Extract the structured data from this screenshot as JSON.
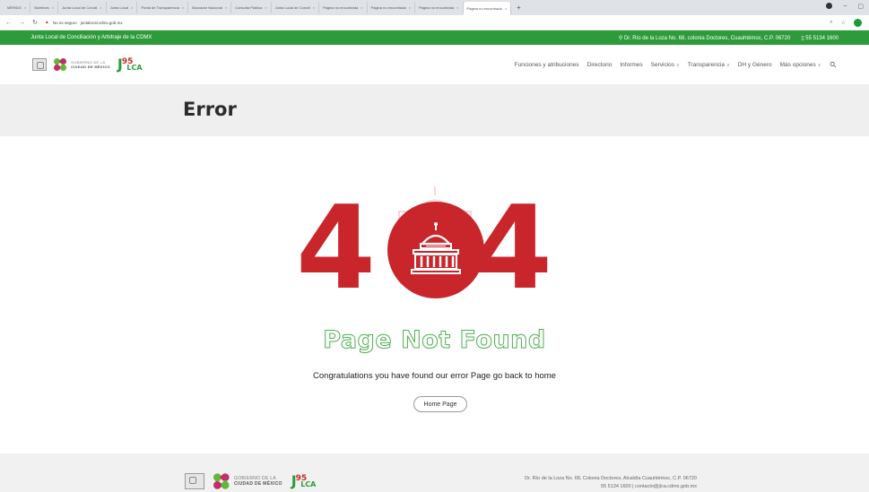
{
  "browser": {
    "tabs": [
      {
        "label": "MÉRIDO",
        "active": false
      },
      {
        "label": "Boletines",
        "active": false
      },
      {
        "label": "Junta Local de Concili",
        "active": false
      },
      {
        "label": "Junta Local",
        "active": false
      },
      {
        "label": "Portal de Transparencia",
        "active": false
      },
      {
        "label": "Buscador Nacional",
        "active": false
      },
      {
        "label": "Consulta Pública",
        "active": false
      },
      {
        "label": "Junta Local de Concili",
        "active": false
      },
      {
        "label": "Página no encontrada",
        "active": false
      },
      {
        "label": "Página no encontrada",
        "active": false
      },
      {
        "label": "Página no encontrada",
        "active": false
      },
      {
        "label": "Página no encontrada",
        "active": true
      }
    ],
    "url_warning": "No es seguro",
    "url": "juntalocal.cdmx.gob.mx"
  },
  "topbar": {
    "left_text": "Junta Local de Conciliación y Arbitraje de la CDMX",
    "address": "Dr. Río de la Loza No. 68, colonia Doctores, Cuauhtémoc, C.P. 06720",
    "phone": "55 5134 1600"
  },
  "logos": {
    "cdmx_line1": "GOBIERNO DE LA",
    "cdmx_line2": "CIUDAD DE MÉXICO",
    "jlca_letter": "J",
    "jlca_number": "95",
    "jlca_rest": "LCA"
  },
  "nav": {
    "items": [
      {
        "label": "Funciones y atribuciones",
        "dropdown": false
      },
      {
        "label": "Directorio",
        "dropdown": false
      },
      {
        "label": "Informes",
        "dropdown": false
      },
      {
        "label": "Servicios",
        "dropdown": true
      },
      {
        "label": "Transparencia",
        "dropdown": true
      },
      {
        "label": "DH y Género",
        "dropdown": false
      },
      {
        "label": "Más opciones",
        "dropdown": true
      }
    ]
  },
  "page": {
    "title": "Error",
    "digit_left": "4",
    "digit_right": "4",
    "not_found": "Page Not Found",
    "message": "Congratulations you have found our error Page go back to home",
    "home_button": "Home Page"
  },
  "footer": {
    "address_line1": "Dr. Río de la Loza No. 68, Colonia Doctores, Alcaldía Cuauhtémoc, C.P. 06720",
    "address_line2": "55 5134 1600 | contacto@jlca.cdmx.gob.mx"
  },
  "colors": {
    "brand_green": "#2e9b3b",
    "error_red": "#c9262c",
    "outline_green": "#4caf50"
  }
}
